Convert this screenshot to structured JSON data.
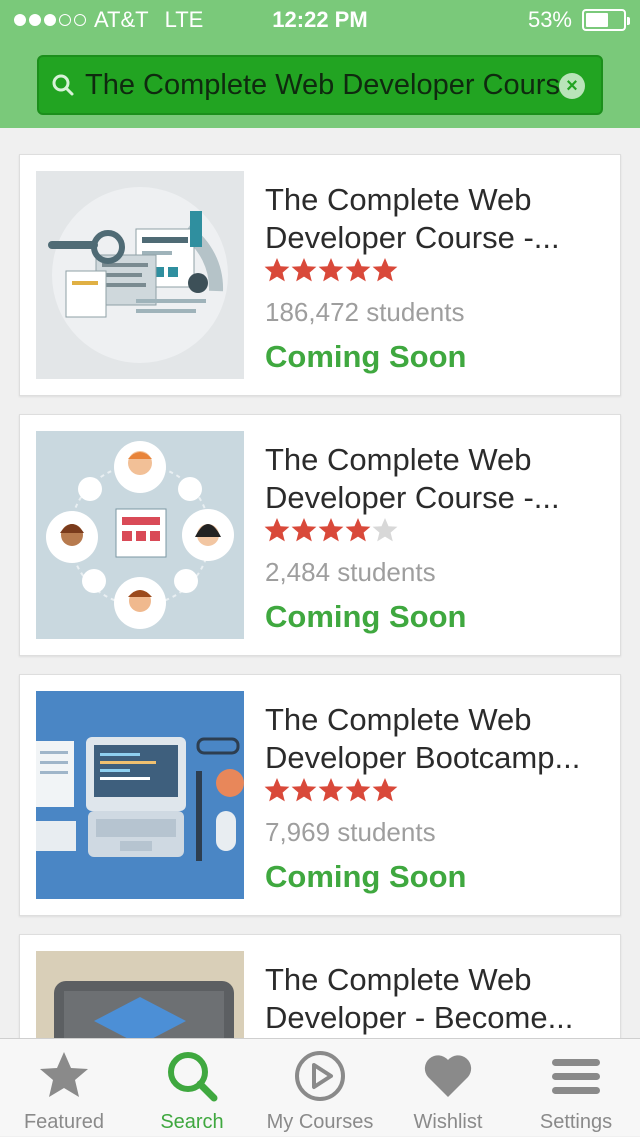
{
  "status_bar": {
    "carrier": "AT&T",
    "network": "LTE",
    "time": "12:22 PM",
    "battery": "53%"
  },
  "search": {
    "query": "The Complete Web Developer Course"
  },
  "courses": [
    {
      "title_line1": "The Complete Web",
      "title_line2": "Developer Course -...",
      "rating": 5,
      "students": "186,472 students",
      "status": "Coming Soon"
    },
    {
      "title_line1": "The Complete Web",
      "title_line2": "Developer Course -...",
      "rating": 4,
      "students": "2,484 students",
      "status": "Coming Soon"
    },
    {
      "title_line1": "The Complete Web",
      "title_line2": "Developer Bootcamp...",
      "rating": 5,
      "students": "7,969 students",
      "status": "Coming Soon"
    },
    {
      "title_line1": "The Complete Web",
      "title_line2": "Developer - Become..."
    }
  ],
  "tabs": [
    {
      "label": "Featured",
      "icon": "star-icon"
    },
    {
      "label": "Search",
      "icon": "search-icon",
      "active": true
    },
    {
      "label": "My Courses",
      "icon": "play-circle-icon"
    },
    {
      "label": "Wishlist",
      "icon": "heart-icon"
    },
    {
      "label": "Settings",
      "icon": "menu-icon"
    }
  ],
  "colors": {
    "header": "#7ac97a",
    "search_field": "#22a422",
    "accent_green": "#3fa83f",
    "star_red": "#d9493a",
    "star_empty": "#d8d8d8"
  }
}
